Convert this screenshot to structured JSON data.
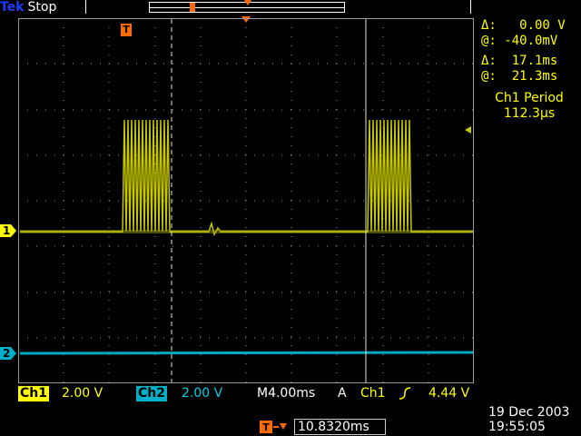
{
  "header": {
    "brand": "Tek",
    "acq_state": "Stop"
  },
  "markers": {
    "trigger_glyph": "T",
    "ch1_glyph": "1",
    "ch2_glyph": "2"
  },
  "cursor_readout": {
    "v_delta": "Δ:   0.00 V",
    "v_at": "@: -40.0mV",
    "t_delta": "Δ:  17.1ms",
    "t_at": "@:  21.3ms"
  },
  "measurement": {
    "label": "Ch1 Period",
    "value": "112.3µs"
  },
  "status_bar": {
    "ch1_label": "Ch1",
    "ch1_scale": "2.00 V",
    "ch2_label": "Ch2",
    "ch2_scale": "2.00 V",
    "timebase": "M4.00ms",
    "trigger_mode": "A",
    "trigger_source": "Ch1",
    "trigger_slope_icon": "rising-edge-icon",
    "trigger_level": "4.44 V",
    "horizontal_position": "10.8320ms"
  },
  "timestamp": {
    "date": "19 Dec  2003",
    "time": "19:55:05"
  },
  "colors": {
    "ch1": "#c8c800",
    "ch2": "#00a8c0",
    "trigger": "#ff6a00"
  }
}
